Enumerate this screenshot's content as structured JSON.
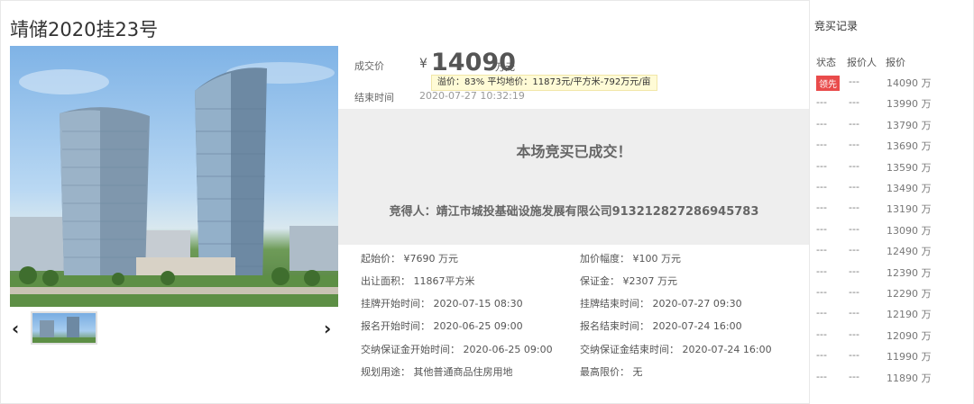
{
  "lot": {
    "title": "靖储2020挂23号"
  },
  "summary": {
    "price_label": "成交价",
    "currency": "¥",
    "price": "14090",
    "price_unit": "万元",
    "end_label": "结束时间",
    "end_time": "2020-07-27 10:32:19",
    "tooltip": "溢价：83%  平均地价：11873元/平方米-792万元/亩"
  },
  "result": {
    "headline": "本场竞买已成交！",
    "winner": "竞得人：靖江市城投基础设施发展有限公司913212827286945783"
  },
  "details": {
    "start_price": "起始价： ¥7690 万元",
    "increment": "加价幅度： ¥100 万元",
    "area": "出让面积： 11867平方米",
    "deposit": "保证金： ¥2307 万元",
    "listing_start": "挂牌开始时间： 2020-07-15 08:30",
    "listing_end": "挂牌结束时间： 2020-07-27 09:30",
    "signup_start": "报名开始时间： 2020-06-25 09:00",
    "signup_end": "报名结束时间： 2020-07-24 16:00",
    "deposit_start": "交纳保证金开始时间： 2020-06-25 09:00",
    "deposit_end": "交纳保证金结束时间： 2020-07-24 16:00",
    "usage": "规划用途： 其他普通商品住房用地",
    "limit": "最高限价： 无"
  },
  "gallery": {
    "prev_glyph": "‹",
    "next_glyph": "›"
  },
  "bids": {
    "title": "竞买记录",
    "headers": {
      "status": "状态",
      "bidder": "报价人",
      "price": "报价"
    },
    "lead_label": "领先",
    "rows": [
      {
        "status": "领先",
        "bidder": "---",
        "price": "14090 万"
      },
      {
        "status": "---",
        "bidder": "---",
        "price": "13990 万"
      },
      {
        "status": "---",
        "bidder": "---",
        "price": "13790 万"
      },
      {
        "status": "---",
        "bidder": "---",
        "price": "13690 万"
      },
      {
        "status": "---",
        "bidder": "---",
        "price": "13590 万"
      },
      {
        "status": "---",
        "bidder": "---",
        "price": "13490 万"
      },
      {
        "status": "---",
        "bidder": "---",
        "price": "13190 万"
      },
      {
        "status": "---",
        "bidder": "---",
        "price": "13090 万"
      },
      {
        "status": "---",
        "bidder": "---",
        "price": "12490 万"
      },
      {
        "status": "---",
        "bidder": "---",
        "price": "12390 万"
      },
      {
        "status": "---",
        "bidder": "---",
        "price": "12290 万"
      },
      {
        "status": "---",
        "bidder": "---",
        "price": "12190 万"
      },
      {
        "status": "---",
        "bidder": "---",
        "price": "12090 万"
      },
      {
        "status": "---",
        "bidder": "---",
        "price": "11990 万"
      },
      {
        "status": "---",
        "bidder": "---",
        "price": "11890 万"
      }
    ]
  }
}
